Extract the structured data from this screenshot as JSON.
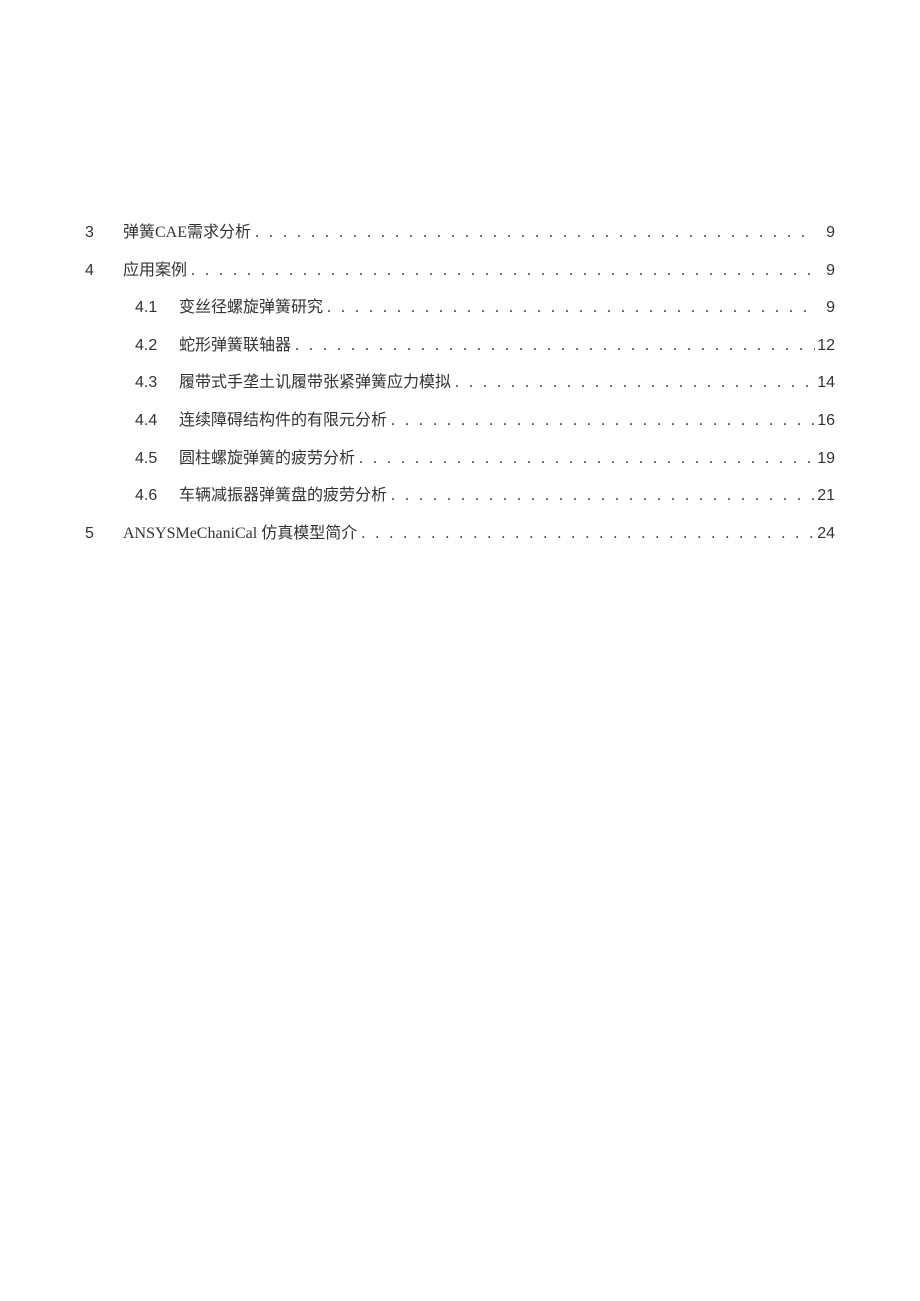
{
  "toc": [
    {
      "level": 1,
      "num": "3",
      "title": "弹簧CAE需求分析",
      "page": "9"
    },
    {
      "level": 1,
      "num": "4",
      "title": "应用案例",
      "page": "9"
    },
    {
      "level": 2,
      "num": "4.1",
      "title": "变丝径螺旋弹簧研究",
      "page": "9"
    },
    {
      "level": 2,
      "num": "4.2",
      "title": "蛇形弹簧联轴器",
      "page": "12"
    },
    {
      "level": 2,
      "num": "4.3",
      "title": "履带式手垄土讥履带张紧弹簧应力模拟",
      "page": "14"
    },
    {
      "level": 2,
      "num": "4.4",
      "title": "连续障碍结构件的有限元分析",
      "page": "16"
    },
    {
      "level": 2,
      "num": "4.5",
      "title": "圆柱螺旋弹簧的疲劳分析",
      "page": "19"
    },
    {
      "level": 2,
      "num": "4.6",
      "title": "车辆减振器弹簧盘的疲劳分析",
      "page": "21"
    },
    {
      "level": 1,
      "num": "5",
      "title": "ANSYSMeChaniCal 仿真模型简介",
      "page": "24"
    }
  ]
}
